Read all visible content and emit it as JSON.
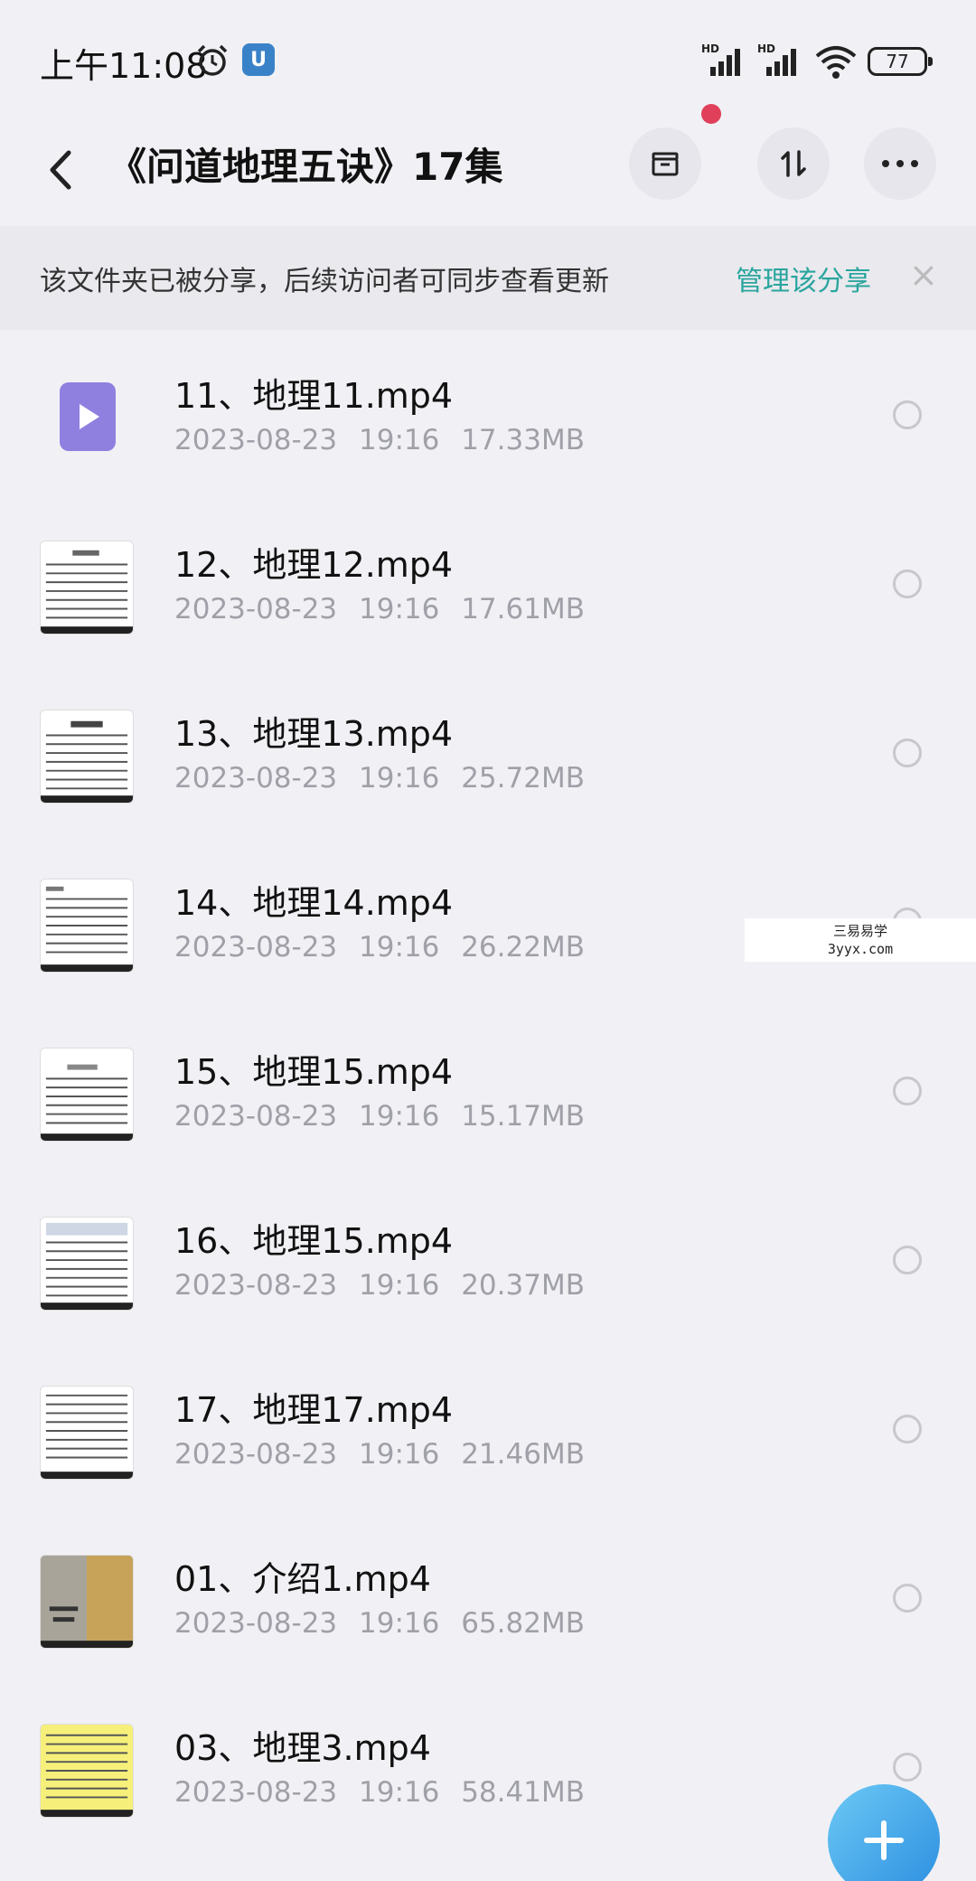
{
  "status_bar": {
    "time": "上午11:08",
    "app_badge": "U",
    "signal_1_label": "HD",
    "signal_2_label": "HD",
    "battery": "77"
  },
  "header": {
    "title": "《问道地理五诀》17集"
  },
  "share_banner": {
    "text": "该文件夹已被分享，后续访问者可同步查看更新",
    "link": "管理该分享",
    "close": "×"
  },
  "files": [
    {
      "name": "11、地理11.mp4",
      "meta": "2023-08-23 19:16 17.33MB",
      "thumb": "video"
    },
    {
      "name": "12、地理12.mp4",
      "meta": "2023-08-23 19:16 17.61MB",
      "thumb": "doc"
    },
    {
      "name": "13、地理13.mp4",
      "meta": "2023-08-23 19:16 25.72MB",
      "thumb": "doc"
    },
    {
      "name": "14、地理14.mp4",
      "meta": "2023-08-23 19:16 26.22MB",
      "thumb": "doc"
    },
    {
      "name": "15、地理15.mp4",
      "meta": "2023-08-23 19:16 15.17MB",
      "thumb": "doc"
    },
    {
      "name": "16、地理15.mp4",
      "meta": "2023-08-23 19:16 20.37MB",
      "thumb": "doc"
    },
    {
      "name": "17、地理17.mp4",
      "meta": "2023-08-23 19:16 21.46MB",
      "thumb": "doc"
    },
    {
      "name": "01、介绍1.mp4",
      "meta": "2023-08-23 19:16 65.82MB",
      "thumb": "cover"
    },
    {
      "name": "03、地理3.mp4",
      "meta": "2023-08-23 19:16 58.41MB",
      "thumb": "highlight"
    }
  ],
  "watermark": {
    "line1": "三易易学",
    "line2": "3yyx.com"
  },
  "colors": {
    "accent": "#2aa59e",
    "video_icon": "#8f80e0",
    "fab": "#2c8ee0",
    "badge_dot": "#e0405a"
  }
}
